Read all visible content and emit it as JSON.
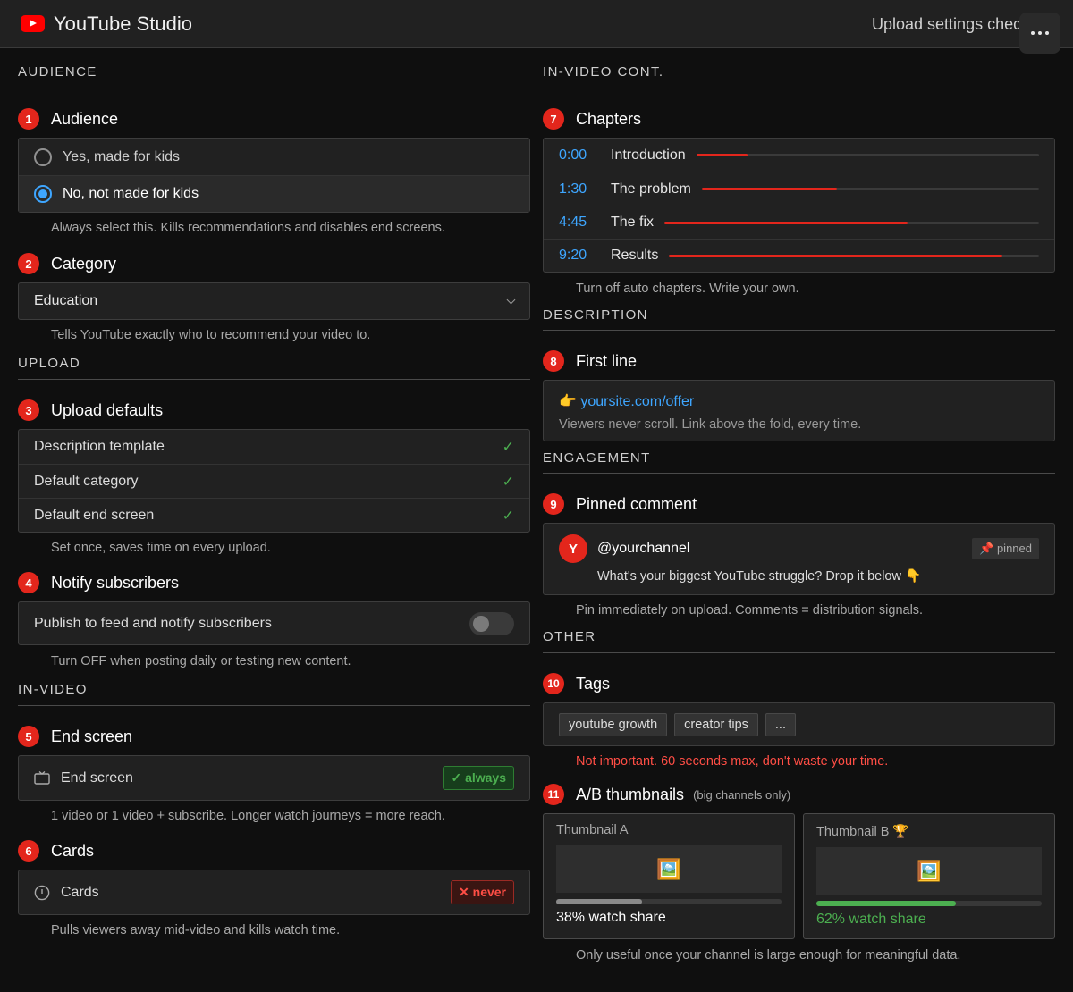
{
  "header": {
    "app_title": "YouTube Studio",
    "page_title": "Upload settings checklist"
  },
  "colors": {
    "accent_red": "#e3261c",
    "link_blue": "#3ea6ff",
    "success_green": "#4caf50"
  },
  "left": {
    "audience_section": "AUDIENCE",
    "audience": {
      "num": "1",
      "title": "Audience",
      "options": [
        {
          "label": "Yes, made for kids",
          "selected": false
        },
        {
          "label": "No, not made for kids",
          "selected": true
        }
      ],
      "note": "Always select this. Kills recommendations and disables end screens."
    },
    "category": {
      "num": "2",
      "title": "Category",
      "value": "Education",
      "note": "Tells YouTube exactly who to recommend your video to."
    },
    "upload_section": "UPLOAD",
    "upload_defaults": {
      "num": "3",
      "title": "Upload defaults",
      "rows": [
        "Description template",
        "Default category",
        "Default end screen"
      ],
      "check": "✓",
      "note": "Set once, saves time on every upload."
    },
    "notify": {
      "num": "4",
      "title": "Notify subscribers",
      "label": "Publish to feed and notify subscribers",
      "note": "Turn OFF when posting daily or testing new content."
    },
    "invideo_section": "IN-VIDEO",
    "end_screen": {
      "num": "5",
      "title": "End screen",
      "row_label": "End screen",
      "badge": "✓ always",
      "note": "1 video or 1 video + subscribe. Longer watch journeys = more reach."
    },
    "cards": {
      "num": "6",
      "title": "Cards",
      "row_label": "Cards",
      "badge": "✕ never",
      "note": "Pulls viewers away mid-video and kills watch time."
    }
  },
  "right": {
    "invideo_cont_section": "IN-VIDEO CONT.",
    "chapters": {
      "num": "7",
      "title": "Chapters",
      "rows": [
        {
          "time": "0:00",
          "label": "Introduction",
          "progress": 0.15
        },
        {
          "time": "1:30",
          "label": "The problem",
          "progress": 0.4
        },
        {
          "time": "4:45",
          "label": "The fix",
          "progress": 0.65
        },
        {
          "time": "9:20",
          "label": "Results",
          "progress": 0.9
        }
      ],
      "note": "Turn off auto chapters. Write your own."
    },
    "description_section": "DESCRIPTION",
    "first_line": {
      "num": "8",
      "title": "First line",
      "emoji": "👉",
      "link": "yoursite.com/offer",
      "hint": "Viewers never scroll. Link above the fold, every time."
    },
    "engagement_section": "ENGAGEMENT",
    "pinned": {
      "num": "9",
      "title": "Pinned comment",
      "avatar": "Y",
      "handle": "@yourchannel",
      "pin_tag": "📌 pinned",
      "text": "What's your biggest YouTube struggle? Drop it below 👇",
      "note": "Pin immediately on upload. Comments = distribution signals."
    },
    "other_section": "OTHER",
    "tags": {
      "num": "10",
      "title": "Tags",
      "items": [
        "youtube growth",
        "creator tips",
        "..."
      ],
      "note": "Not important. 60 seconds max, don't waste your time."
    },
    "ab": {
      "num": "11",
      "title": "A/B thumbnails",
      "subtitle": "(big channels only)",
      "a": {
        "label": "Thumbnail A",
        "image": "🖼️",
        "share": 0.38,
        "share_text": "38% watch share"
      },
      "b": {
        "label": "Thumbnail B 🏆",
        "image": "🖼️",
        "share": 0.62,
        "share_text": "62% watch share"
      },
      "note": "Only useful once your channel is large enough for meaningful data."
    }
  }
}
